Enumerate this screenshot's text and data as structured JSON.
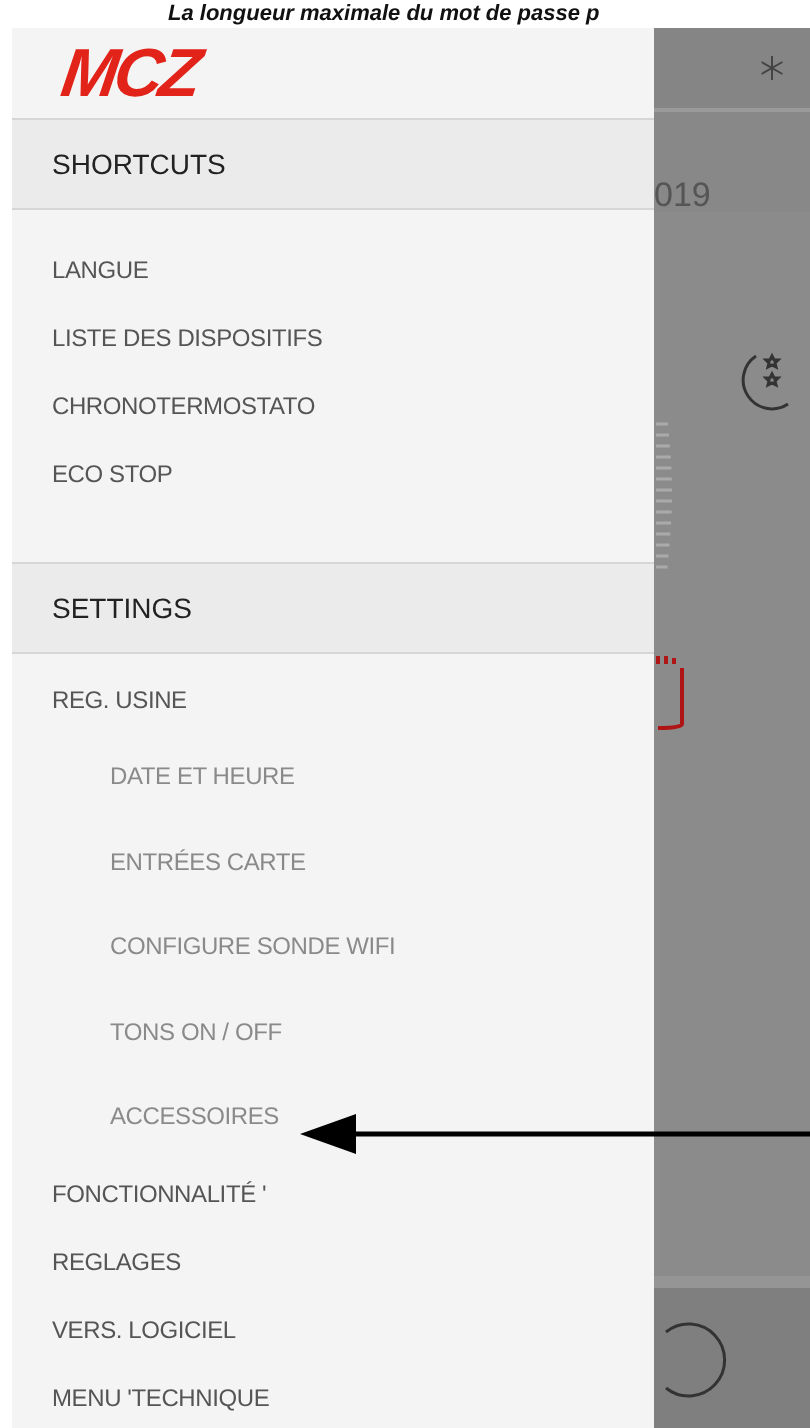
{
  "caption": "La longueur maximale du mot de passe p",
  "logo": "MCZ",
  "background": {
    "date_fragment": "019"
  },
  "sections": [
    {
      "title": "SHORTCUTS",
      "items": [
        {
          "label": "LANGUE",
          "kind": "item"
        },
        {
          "label": "LISTE DES DISPOSITIFS",
          "kind": "item"
        },
        {
          "label": "CHRONOTERMOSTATO",
          "kind": "item"
        },
        {
          "label": "ECO STOP",
          "kind": "item"
        }
      ]
    },
    {
      "title": "SETTINGS",
      "items": [
        {
          "label": "REG. USINE",
          "kind": "item"
        },
        {
          "label": "DATE ET HEURE",
          "kind": "subitem"
        },
        {
          "label": "ENTRÉES CARTE",
          "kind": "subitem"
        },
        {
          "label": "CONFIGURE SONDE WIFI",
          "kind": "subitem"
        },
        {
          "label": "TONS ON / OFF",
          "kind": "subitem"
        },
        {
          "label": "ACCESSOIRES",
          "kind": "subitem"
        },
        {
          "label": "FONCTIONNALITÉ '",
          "kind": "item"
        },
        {
          "label": "REGLAGES",
          "kind": "item"
        },
        {
          "label": "VERS. LOGICIEL",
          "kind": "item"
        },
        {
          "label": "MENU 'TECHNIQUE",
          "kind": "item"
        }
      ]
    }
  ]
}
